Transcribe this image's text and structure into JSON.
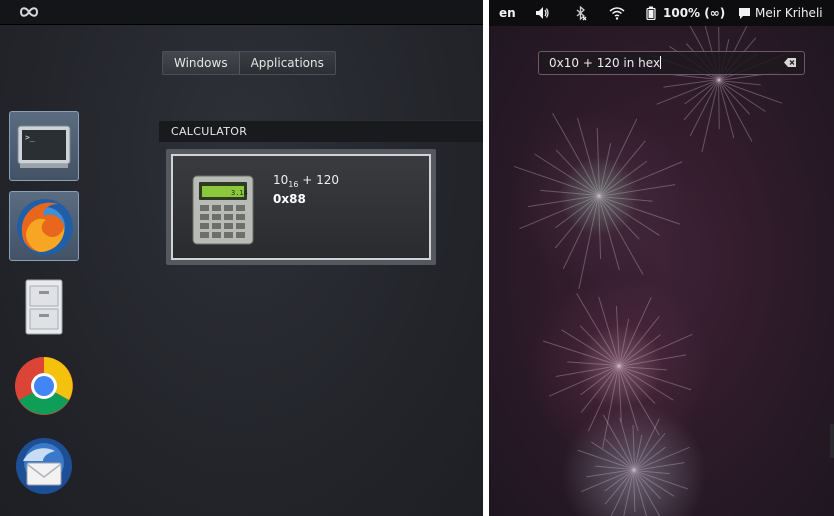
{
  "overview": {
    "activities_icon": "infinity-icon",
    "view_switch": {
      "windows": "Windows",
      "applications": "Applications",
      "active": "windows"
    },
    "dash": [
      {
        "name": "terminal",
        "icon": "terminal-icon",
        "running": true
      },
      {
        "name": "firefox",
        "icon": "firefox-icon",
        "running": true
      },
      {
        "name": "files",
        "icon": "file-cabinet-icon",
        "running": false
      },
      {
        "name": "chrome",
        "icon": "chrome-icon",
        "running": false
      },
      {
        "name": "thunderbird",
        "icon": "thunderbird-icon",
        "running": false
      }
    ],
    "section_title": "CALCULATOR",
    "result": {
      "expr_base": "10",
      "expr_sub": "16",
      "expr_rest": " + 120",
      "value": "0x88",
      "icon_display": "3.14"
    }
  },
  "desktop": {
    "topbar": {
      "keyboard": "en",
      "volume_icon": "volume-icon",
      "bluetooth_icon": "bluetooth-disabled-icon",
      "wifi_icon": "wifi-icon",
      "battery_icon": "battery-icon",
      "battery": "100% (∞)",
      "chat_icon": "chat-bubble-icon",
      "user": "Meir Kriheli"
    },
    "search": {
      "value": "0x10 + 120 in hex"
    }
  }
}
